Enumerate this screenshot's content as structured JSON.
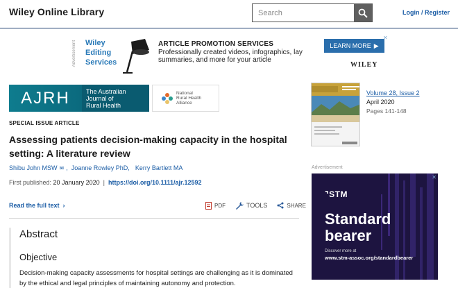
{
  "header": {
    "logo": "Wiley Online Library",
    "search_placeholder": "Search",
    "login": "Login / Register"
  },
  "ad_top": {
    "side_label": "Advertisement",
    "brand_line1": "Wiley",
    "brand_line2": "Editing",
    "brand_line3": "Services",
    "title": "ARTICLE PROMOTION SERVICES",
    "body": "Professionally created videos, infographics, lay summaries, and more for your article",
    "cta": "LEARN MORE",
    "publisher": "WILEY"
  },
  "journal": {
    "logo": "AJRH",
    "name_line1": "The Australian",
    "name_line2": "Journal of",
    "name_line3": "Rural Health",
    "partner_line1": "National",
    "partner_line2": "Rural Health",
    "partner_line3": "Alliance"
  },
  "article": {
    "label": "SPECIAL ISSUE ARTICLE",
    "title": "Assessing patients decision-making capacity in the hospital setting: A literature review",
    "authors": [
      "Shibu John MSW",
      "Joanne Rowley PhD,",
      "Kerry Bartlett MA"
    ],
    "first_published_label": "First published:",
    "first_published_date": "20 January 2020",
    "doi": "https://doi.org/10.1111/ajr.12592",
    "read_full": "Read the full text",
    "pdf_label": "PDF",
    "tools_label": "TOOLS",
    "share_label": "SHARE"
  },
  "abstract": {
    "heading": "Abstract",
    "subheading": "Objective",
    "text": "Decision-making capacity assessments for hospital settings are challenging as it is dominated by the ethical and legal principles of maintaining autonomy and protection."
  },
  "issue": {
    "volume": "Volume 28, Issue 2",
    "date": "April 2020",
    "pages": "Pages 141-148"
  },
  "ad_side": {
    "label": "Advertisement",
    "brand": "STM",
    "headline_line1": "Standard",
    "headline_line2": "bearer",
    "small": "Discover more at",
    "url": "www.stm-assoc.org/standardbearer"
  }
}
